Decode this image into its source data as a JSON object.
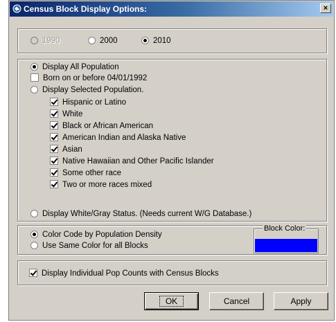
{
  "window": {
    "title": "Census Block Display Options:",
    "close_label": "×"
  },
  "year": {
    "options": [
      {
        "label": "1990",
        "checked": false,
        "disabled": true
      },
      {
        "label": "2000",
        "checked": false,
        "disabled": false
      },
      {
        "label": "2010",
        "checked": true,
        "disabled": false
      }
    ]
  },
  "population": {
    "display_all": "Display All Population",
    "born_before": "Born on or before 04/01/1992",
    "display_selected": "Display Selected Population.",
    "races": [
      "Hispanic or Latino",
      "White",
      "Black or African American",
      "American Indian and Alaska Native",
      "Asian",
      "Native Hawaiian and Other Pacific Islander",
      "Some other race",
      "Two or more races mixed"
    ],
    "white_gray": "Display White/Gray Status. (Needs current W/G Database.)"
  },
  "color": {
    "by_density": "Color Code by Population Density",
    "same_color": "Use Same Color for all Blocks",
    "block_color_label": "Block Color:",
    "block_color": "#0000ff"
  },
  "counts": {
    "label": "Display Individual Pop Counts with Census Blocks"
  },
  "buttons": {
    "ok": "OK",
    "cancel": "Cancel",
    "apply": "Apply"
  }
}
